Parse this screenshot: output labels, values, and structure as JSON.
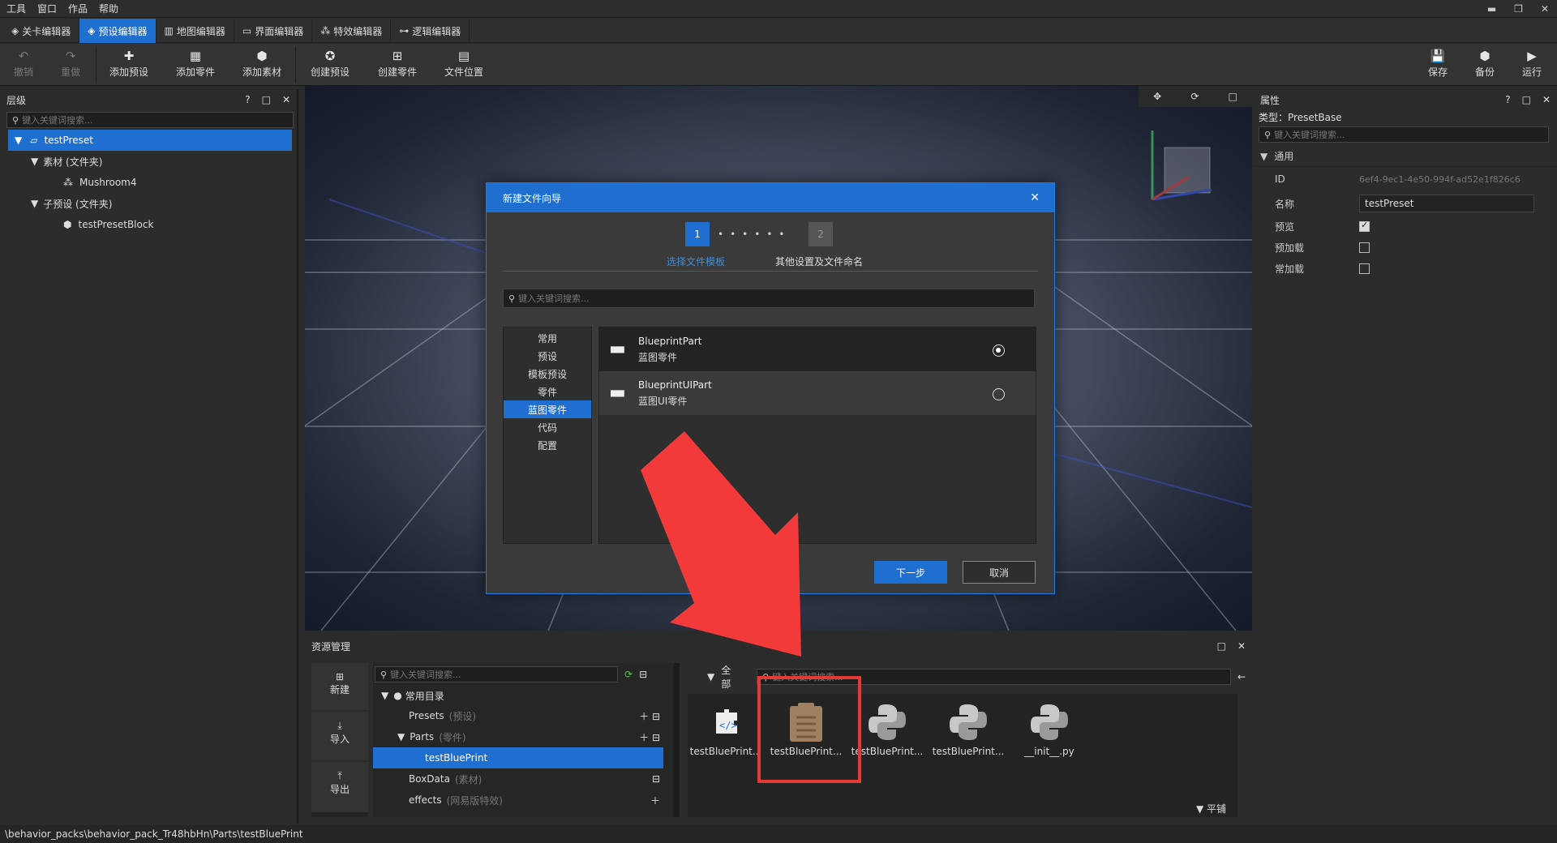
{
  "menu": [
    "工具",
    "窗口",
    "作品",
    "帮助"
  ],
  "editor_tabs": [
    {
      "label": "关卡编辑器",
      "icon": "level-icon"
    },
    {
      "label": "预设编辑器",
      "icon": "preset-icon",
      "active": true
    },
    {
      "label": "地图编辑器",
      "icon": "map-icon"
    },
    {
      "label": "界面编辑器",
      "icon": "ui-icon"
    },
    {
      "label": "特效编辑器",
      "icon": "effects-icon"
    },
    {
      "label": "逻辑编辑器",
      "icon": "logic-icon"
    }
  ],
  "toolbar": {
    "undo": "撤销",
    "redo": "重做",
    "add_preset": "添加预设",
    "add_part": "添加零件",
    "add_asset": "添加素材",
    "create_preset": "创建预设",
    "create_part": "创建零件",
    "file_location": "文件位置",
    "save": "保存",
    "backup": "备份",
    "run": "运行"
  },
  "hierarchy": {
    "title": "层级",
    "search_placeholder": "键入关键词搜索...",
    "root": "testPreset",
    "assets_folder": "素材 (文件夹)",
    "asset_item": "Mushroom4",
    "subpreset_folder": "子预设 (文件夹)",
    "subpreset_item": "testPresetBlock"
  },
  "properties": {
    "title": "属性",
    "type_line": "类型：PresetBase",
    "search_placeholder": "键入关键词搜索...",
    "section": "通用",
    "id_label": "ID",
    "id_value": "6ef4-9ec1-4e50-994f-ad52e1f826c6",
    "name_label": "名称",
    "name_value": "testPreset",
    "preview_label": "预览",
    "preload_label": "预加载",
    "resident_label": "常加载"
  },
  "dialog": {
    "title": "新建文件向导",
    "step1_num": "1",
    "step2_num": "2",
    "step1_label": "选择文件模板",
    "step2_label": "其他设置及文件命名",
    "search_placeholder": "键入关键词搜索...",
    "categories": [
      "常用",
      "预设",
      "模板预设",
      "零件",
      "蓝图零件",
      "代码",
      "配置"
    ],
    "selected_category": 4,
    "templates": [
      {
        "name": "BlueprintPart",
        "desc": "蓝图零件",
        "selected": true
      },
      {
        "name": "BlueprintUIPart",
        "desc": "蓝图UI零件",
        "selected": false
      }
    ],
    "next": "下一步",
    "cancel": "取消"
  },
  "assets": {
    "title": "资源管理",
    "new": "新建",
    "import": "导入",
    "export": "导出",
    "tree_search_placeholder": "键入关键词搜索...",
    "common_dir": "常用目录",
    "tree": [
      {
        "label": "Presets",
        "note": "(预设)"
      },
      {
        "label": "Parts",
        "note": "(零件)"
      },
      {
        "label": "testBluePrint",
        "note": ""
      },
      {
        "label": "BoxData",
        "note": "(素材)"
      },
      {
        "label": "effects",
        "note": "(网易版特效)"
      }
    ],
    "filter_all": "全部",
    "file_search_placeholder": "键入关键词搜索...",
    "files": [
      "testBluePrint...",
      "testBluePrint...",
      "testBluePrint...",
      "testBluePrint...",
      "__init__.py"
    ],
    "tile_label": "平铺"
  },
  "status": "\\behavior_packs\\behavior_pack_Tr48hbHn\\Parts\\testBluePrint",
  "colors": {
    "accent": "#1f6fd1",
    "highlight": "#e53935",
    "arrow": "#f23a3a"
  }
}
